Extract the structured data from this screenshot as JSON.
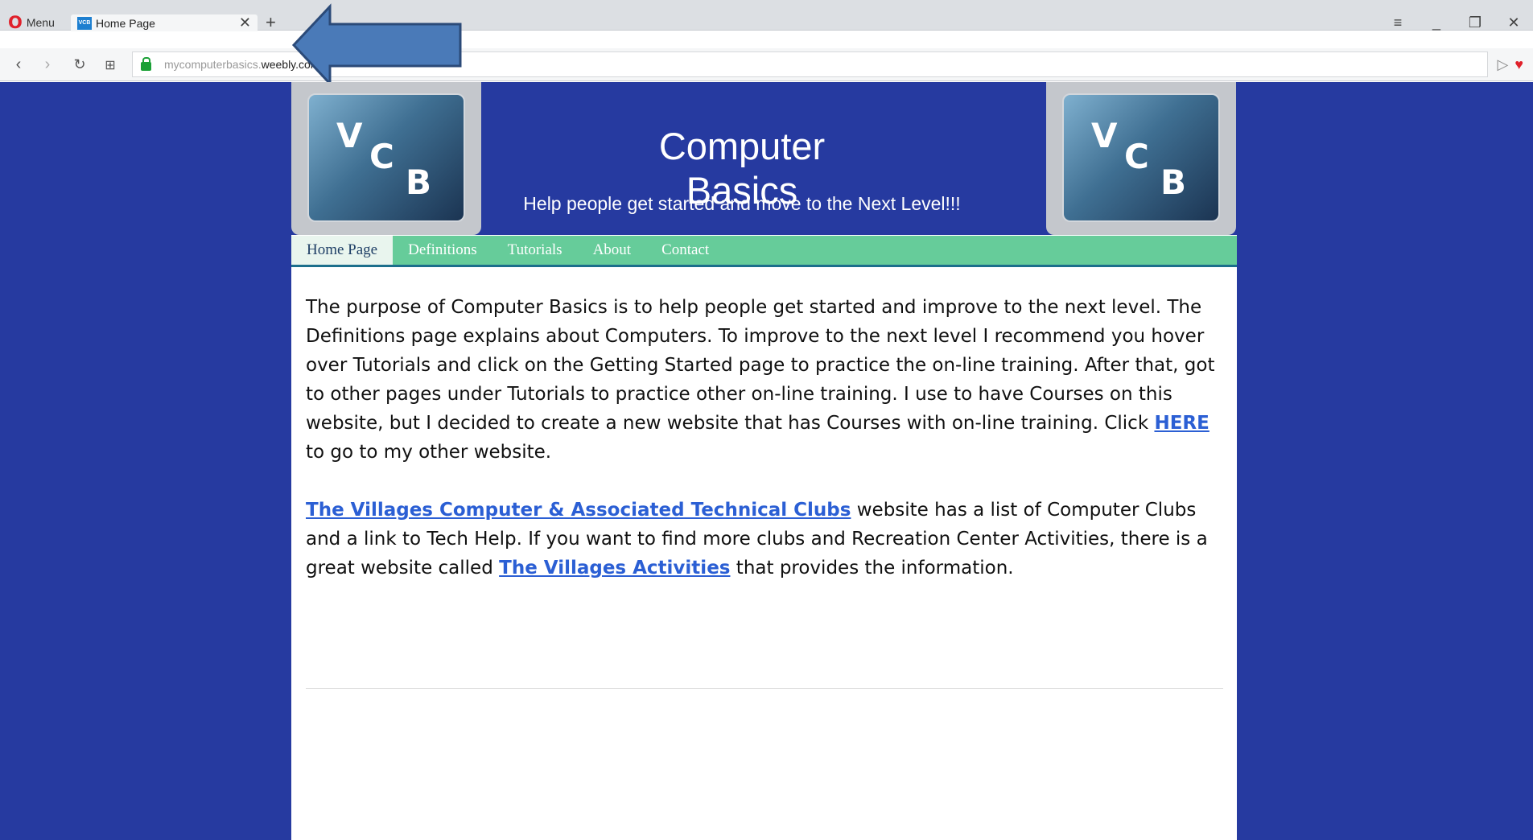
{
  "browser": {
    "menu_label": "Menu",
    "tab": {
      "favicon_text": "VCB",
      "title": "Home Page"
    },
    "url": {
      "subdomain": "mycomputerbasics.",
      "domain": "weebly.com"
    }
  },
  "site": {
    "logo_letters": {
      "v": "V",
      "c": "C",
      "b": "B"
    },
    "title": "Computer Basics",
    "tagline": "Help people get started and move to the Next Level!!!"
  },
  "nav": {
    "items": [
      {
        "label": "Home Page"
      },
      {
        "label": "Definitions"
      },
      {
        "label": "Tutorials"
      },
      {
        "label": "About"
      },
      {
        "label": "Contact"
      }
    ]
  },
  "content": {
    "para1_text": "The purpose of Computer Basics is to help people get started and improve to the next level.  The Definitions page explains about Computers.  To improve to the next level I recommend you hover over Tutorials and click on the Getting Started page to practice the on-line training.  After that, got to other pages under Tutorials to practice other on-line training.  I use to have Courses on this website, but I decided to create a new website that has Courses with on-line training.  Click ",
    "para1_link": "HERE",
    "para1_tail": " to go to my other website.",
    "para2_link1": "The Villages Computer & Associated Technical Clubs",
    "para2_text1": " website has a list of Computer Clubs and a link to Tech Help.  If you want to find more clubs and Recreation Center Activities, there is a great website called ",
    "para2_link2": "The Villages Activities",
    "para2_text2": " that provides the information."
  },
  "colors": {
    "page_background": "#263aa0",
    "nav_background": "#66cc9a",
    "link": "#2b5fd4",
    "annotation_arrow": "#4a7ab8"
  }
}
